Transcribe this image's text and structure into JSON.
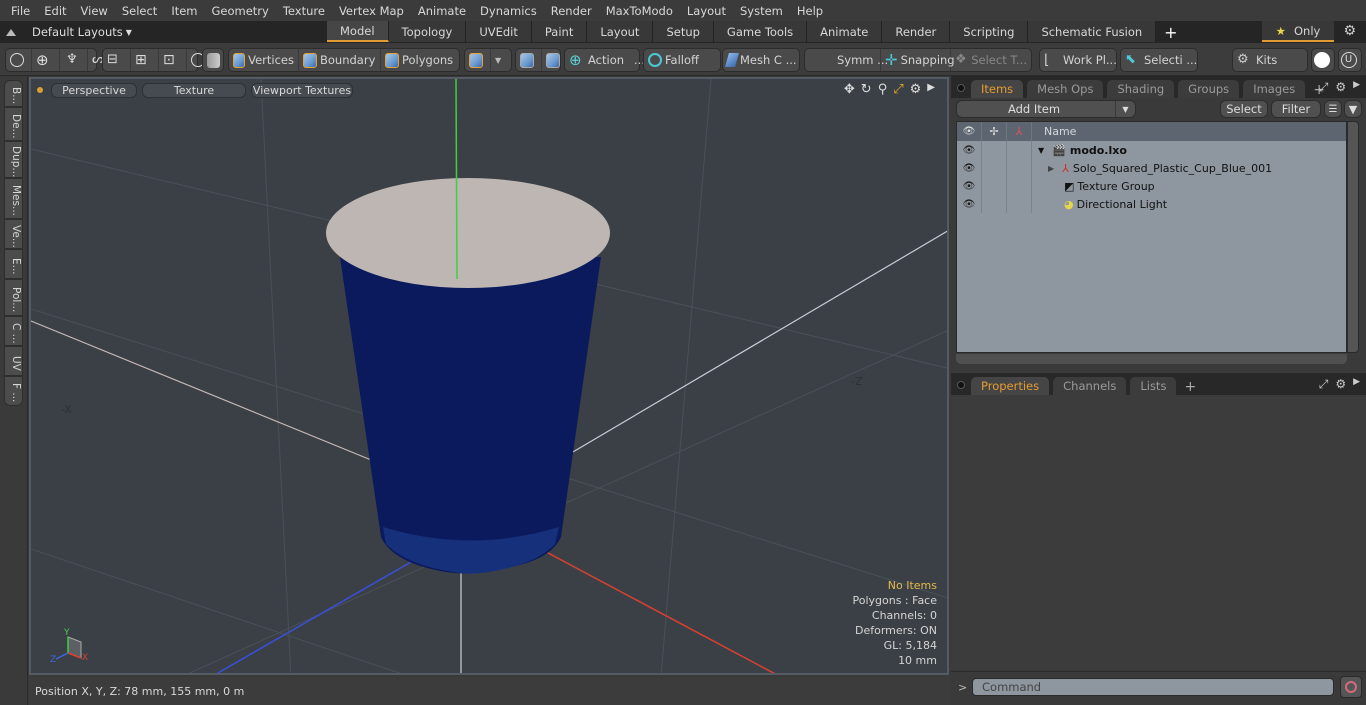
{
  "menu": [
    "File",
    "Edit",
    "View",
    "Select",
    "Item",
    "Geometry",
    "Texture",
    "Vertex Map",
    "Animate",
    "Dynamics",
    "Render",
    "MaxToModo",
    "Layout",
    "System",
    "Help"
  ],
  "layouts": {
    "label": "Default Layouts",
    "tabs": [
      "Model",
      "Topology",
      "UVEdit",
      "Paint",
      "Layout",
      "Setup",
      "Game Tools",
      "Animate",
      "Render",
      "Scripting",
      "Schematic Fusion"
    ],
    "active": "Model",
    "only_label": "Only"
  },
  "toolbar": {
    "vertices": "Vertices",
    "boundary": "Boundary",
    "polygons": "Polygons",
    "action": "Action",
    "falloff": "Falloff",
    "mesh": "Mesh C ...",
    "symm": "Symm ...",
    "snapping": "Snapping",
    "select_t": "Select T...",
    "workpl": "Work Pl...",
    "selecti": "Selecti ...",
    "kits": "Kits",
    "ellipsis": "..."
  },
  "left_tabs": [
    "B...",
    "De...",
    "Dup...",
    "Mes...",
    "Ve...",
    "E...",
    "Pol...",
    "C ...",
    "UV",
    "F ..."
  ],
  "viewport": {
    "view": "Perspective",
    "shading": "Texture",
    "textures": "Viewport Textures",
    "axis_neg_x": "-X",
    "axis_neg_z": "-Z",
    "gizmo": {
      "x": "X",
      "y": "Y",
      "z": "Z"
    },
    "info": {
      "selection": "No Items",
      "polygons": "Polygons : Face",
      "channels": "Channels: 0",
      "deformers": "Deformers: ON",
      "gl": "GL: 5,184",
      "unit": "10 mm"
    },
    "colors": {
      "cup": "#0a1a5c",
      "rim": "#bdb6b2",
      "x_axis": "#d9412f",
      "y_axis": "#3fd040",
      "z_axis": "#3a4fd8"
    }
  },
  "status": {
    "position": "Position X, Y, Z:   78 mm, 155 mm, 0 m"
  },
  "items_panel": {
    "tabs": [
      "Items",
      "Mesh Ops",
      "Shading",
      "Groups",
      "Images"
    ],
    "active": "Items",
    "add_item": "Add Item",
    "select": "Select",
    "filter": "Filter",
    "name_col": "Name",
    "rows": [
      {
        "name": "modo.lxo",
        "type": "scene"
      },
      {
        "name": "Solo_Squared_Plastic_Cup_Blue_001",
        "type": "mesh"
      },
      {
        "name": "Texture Group",
        "type": "texture-group"
      },
      {
        "name": "Directional Light",
        "type": "light"
      }
    ]
  },
  "props_panel": {
    "tabs": [
      "Properties",
      "Channels",
      "Lists"
    ],
    "active": "Properties"
  },
  "command": {
    "placeholder": "Command",
    "prompt": ">"
  },
  "accent": "#e39c34"
}
